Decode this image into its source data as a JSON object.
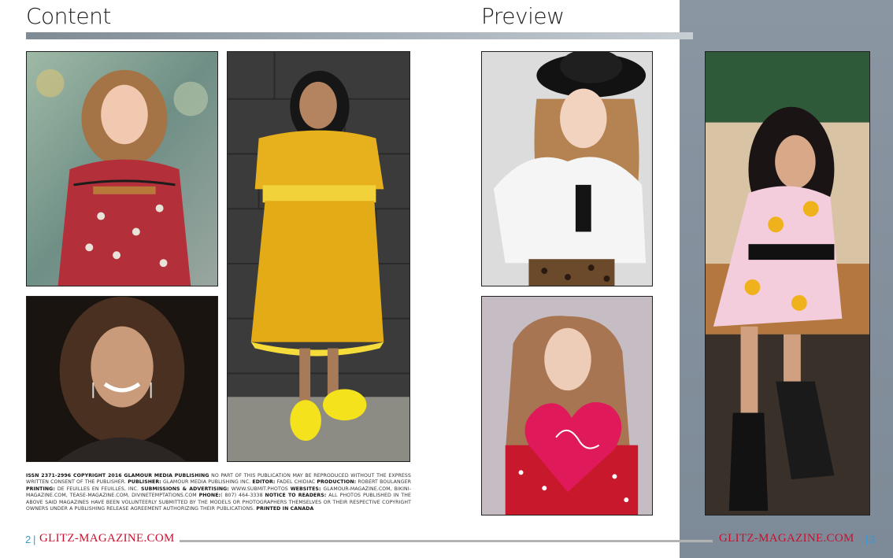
{
  "left_page": {
    "heading": "Content",
    "legal_parts": [
      {
        "t": "ISSN 2371-2996 COPYRIGHT 2016 GLAMOUR MEDIA PUBLISHING",
        "b": true
      },
      {
        "t": " NO PART OF THIS PUBLICATION MAY BE REPRODUCED WITHOUT THE EXPRESS WRITTEN CONSENT OF THE PUBLISHER. ",
        "b": false
      },
      {
        "t": "PUBLISHER:",
        "b": true
      },
      {
        "t": " GLAMOUR MEDIA PUBLISHING INC. ",
        "b": false
      },
      {
        "t": "EDITOR:",
        "b": true
      },
      {
        "t": " FADEL CHIDIAC ",
        "b": false
      },
      {
        "t": "PRODUCTION:",
        "b": true
      },
      {
        "t": " ROBERT BOULANGER ",
        "b": false
      },
      {
        "t": "PRINTING:",
        "b": true
      },
      {
        "t": " DE FEUILLES EN FEUILLES, INC. ",
        "b": false
      },
      {
        "t": "SUBMISSIONS & ADVERTISING:",
        "b": true
      },
      {
        "t": " WWW.SUBMIT.PHOTOS ",
        "b": false
      },
      {
        "t": "WEBSITES:",
        "b": true
      },
      {
        "t": " GLAMOUR-MAGAZINE.COM, BIKINI-MAGAZINE.COM, TEASE-MAGAZINE.COM, DIVINETEMPTATIONS.COM ",
        "b": false
      },
      {
        "t": "PHONE:",
        "b": true
      },
      {
        "t": "( 807) 464-3338 ",
        "b": false
      },
      {
        "t": "NOTICE TO READERS:",
        "b": true
      },
      {
        "t": " ALL PHOTOS PUBLISHED IN THE ABOVE SAID MAGAZINES HAVE BEEN VOLUNTEERLY SUBMITTED BY THE MODELS OR PHOTOGRAPHERS THEMSELVES OR THEIR RESPECTIVE COPYRIGHT OWNERS UNDER A PUBLISHING RELEASE AGREEMENT AUTHORIZING THEIR PUBLICATIONS. ",
        "b": false
      },
      {
        "t": "PRINTED IN CANADA",
        "b": true
      }
    ],
    "page_number": "2",
    "brand": "GLITZ-MAGAZINE.COM"
  },
  "right_page": {
    "heading": "Preview",
    "page_number": "3",
    "brand": "GLITZ-MAGAZINE.COM"
  },
  "colors": {
    "brand_red": "#c8102e",
    "page_number_blue": "#2d9cdb",
    "panel_gray": "#84909c"
  },
  "photos": [
    {
      "name": "photo-girl-floral-dress",
      "palette": [
        "#6e8f7a",
        "#b23a3a"
      ]
    },
    {
      "name": "photo-girl-yellow-dress",
      "palette": [
        "#3a3a3a",
        "#e0b21a"
      ]
    },
    {
      "name": "photo-woman-smiling-portrait",
      "palette": [
        "#1e1612",
        "#6b4a36"
      ]
    },
    {
      "name": "photo-girl-black-hat",
      "palette": [
        "#d9d9d9",
        "#f4f4f4"
      ]
    },
    {
      "name": "photo-girl-heart-pillow",
      "palette": [
        "#c9c0c8",
        "#e01e5a"
      ]
    },
    {
      "name": "photo-girl-sunflower-dress",
      "palette": [
        "#b88a5c",
        "#f2c7d3"
      ]
    }
  ]
}
